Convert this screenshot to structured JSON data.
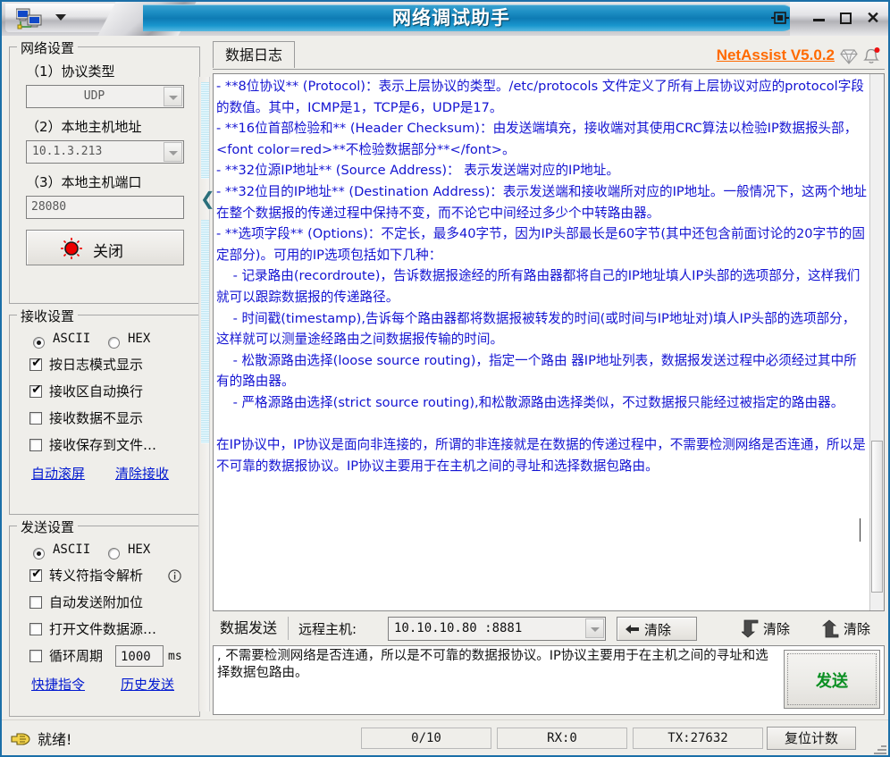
{
  "window": {
    "title": "网络调试助手",
    "app_icon": "network-computers-icon",
    "menu_caret": "dropdown-caret-icon",
    "pin": "pin-icon",
    "minimize": "−",
    "maximize": "□",
    "close": "✕"
  },
  "network_settings": {
    "group_title": "网络设置",
    "protocol_label": "（1）协议类型",
    "protocol_value": "UDP",
    "host_addr_label": "（2）本地主机地址",
    "host_addr_value": "10.1.3.213",
    "host_port_label": "（3）本地主机端口",
    "host_port_value": "28080",
    "connect_button": "关闭"
  },
  "receive_settings": {
    "group_title": "接收设置",
    "ascii_label": "ASCII",
    "hex_label": "HEX",
    "ascii_selected": true,
    "checks": [
      {
        "label": "按日志模式显示",
        "checked": true
      },
      {
        "label": "接收区自动换行",
        "checked": true
      },
      {
        "label": "接收数据不显示",
        "checked": false
      },
      {
        "label": "接收保存到文件…",
        "checked": false
      }
    ],
    "link_autoscroll": "自动滚屏",
    "link_clear": "清除接收"
  },
  "send_settings": {
    "group_title": "发送设置",
    "ascii_label": "ASCII",
    "hex_label": "HEX",
    "ascii_selected": true,
    "checks": [
      {
        "label": "转义符指令解析",
        "checked": true,
        "info": "ⓘ"
      },
      {
        "label": "自动发送附加位",
        "checked": false
      },
      {
        "label": "打开文件数据源…",
        "checked": false
      }
    ],
    "cycle_label": "循环周期",
    "cycle_checked": false,
    "cycle_value": "1000",
    "cycle_unit": "ms",
    "link_quick": "快捷指令",
    "link_history": "历史发送"
  },
  "log_panel": {
    "tab_label": "数据日志",
    "brand": "NetAssist V5.0.2",
    "diamond_icon": "diamond-icon",
    "bell_icon": "bell-notification-icon",
    "text": "- **8位协议** (Protocol)：表示上层协议的类型。/etc/protocols 文件定义了所有上层协议对应的protocol字段的数值。其中，ICMP是1，TCP是6，UDP是17。\n- **16位首部检验和** (Header Checksum)：由发送端填充，接收端对其使用CRC算法以检验IP数据报头部，<font color=red>**不检验数据部分**</font>。\n- **32位源IP地址** (Source Address)： 表示发送端对应的IP地址。\n- **32位目的IP地址** (Destination Address)：表示发送端和接收端所对应的IP地址。一般情况下，这两个地址在整个数据报的传递过程中保持不变，而不论它中间经过多少个中转路由器。\n- **选项字段** (Options)：不定长，最多40字节，因为IP头部最长是60字节(其中还包含前面讨论的20字节的固定部分)。可用的IP选项包括如下几种：\n    - 记录路由(recordroute)，告诉数据报途经的所有路由器都将自己的IP地址填人IP头部的选项部分，这样我们就可以跟踪数据报的传递路径。\n    - 时间戳(timestamp),告诉每个路由器都将数据报被转发的时间(或时间与IP地址对)填人IP头部的选项部分，这样就可以测量途经路由之间数据报传输的时间。\n    - 松散源路由选择(loose source routing)，指定一个路由 器IP地址列表，数据报发送过程中必须经过其中所有的路由器。\n    - 严格源路由选择(strict source routing),和松散源路由选择类似，不过数据报只能经过被指定的路由器。\n\n在IP协议中，IP协议是面向非连接的，所谓的非连接就是在数据的传递过程中，不需要检测网络是否连通，所以是不可靠的数据报协议。IP协议主要用于在主机之间的寻址和选择数据包路由。"
  },
  "send_panel": {
    "tab_label": "数据发送",
    "remote_host_label": "远程主机:",
    "remote_host_value": "10.10.10.80 :8881",
    "clear_back_button": "清除",
    "clear_down_button": "清除",
    "clear_up_button": "清除",
    "send_text": ", 不需要检测网络是否连通，所以是不可靠的数据报协议。IP协议主要用于在主机之间的寻址和选择数据包路由。",
    "send_button": "发送"
  },
  "status": {
    "ready_icon": "pointing-hand-icon",
    "ready_text": "就绪!",
    "counter": "0/10",
    "rx": "RX:0",
    "tx": "TX:27632",
    "reset_button": "复位计数"
  },
  "colors": {
    "title_blue": "#0e7bb4",
    "log_text_blue": "#1414d2",
    "brand_orange": "#ff6a00",
    "link_blue": "#0018d0",
    "send_green": "#0a8f22",
    "indicator_red": "#ee0000"
  }
}
